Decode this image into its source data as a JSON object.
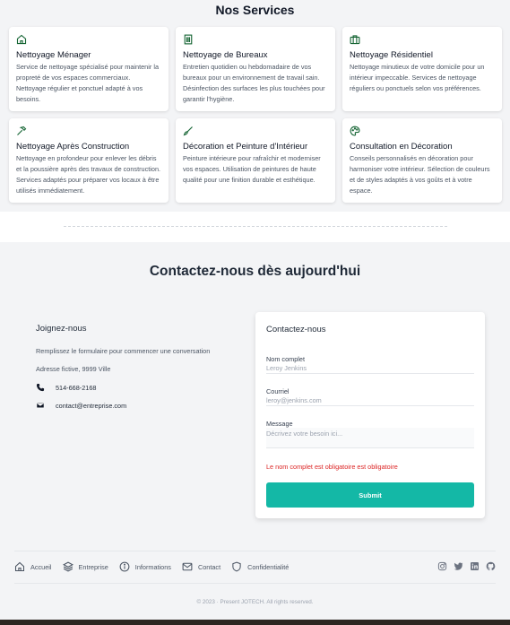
{
  "services": {
    "title": "Nos Services",
    "cards": [
      {
        "icon": "home-icon",
        "title": "Nettoyage Ménager",
        "desc": "Service de nettoyage spécialisé pour maintenir la propreté de vos espaces commerciaux. Nettoyage régulier et ponctuel adapté à vos besoins."
      },
      {
        "icon": "building-icon",
        "title": "Nettoyage de Bureaux",
        "desc": "Entretien quotidien ou hebdomadaire de vos bureaux pour un environnement de travail sain. Désinfection des surfaces les plus touchées pour garantir l'hygiène."
      },
      {
        "icon": "briefcase-icon",
        "title": "Nettoyage Résidentiel",
        "desc": "Nettoyage minutieux de votre domicile pour un intérieur impeccable. Services de nettoyage réguliers ou ponctuels selon vos préférences."
      },
      {
        "icon": "hammer-icon",
        "title": "Nettoyage Après Construction",
        "desc": "Nettoyage en profondeur pour enlever les débris et la poussière après des travaux de construction. Services adaptés pour préparer vos locaux à être utilisés immédiatement."
      },
      {
        "icon": "paint-brush-icon",
        "title": "Décoration et Peinture d'Intérieur",
        "desc": "Peinture intérieure pour rafraîchir et moderniser vos espaces. Utilisation de peintures de haute qualité pour une finition durable et esthétique."
      },
      {
        "icon": "palette-icon",
        "title": "Consultation en Décoration",
        "desc": "Conseils personnalisés en décoration pour harmoniser votre intérieur. Sélection de couleurs et de styles adaptés à vos goûts et à votre espace."
      }
    ]
  },
  "contact": {
    "title": "Contactez-nous dès aujourd'hui",
    "join": {
      "title": "Joignez-nous",
      "desc": "Remplissez le formulaire pour commencer une conversation",
      "address": "Adresse fictive, 9999 Ville",
      "phone": "514-668-2168",
      "email": "contact@entreprise.com"
    },
    "form": {
      "title": "Contactez-nous",
      "name_label": "Nom complet",
      "name_placeholder": "Leroy Jenkins",
      "email_label": "Courriel",
      "email_placeholder": "leroy@jenkins.com",
      "message_label": "Message",
      "message_placeholder": "Décrivez votre besoin ici...",
      "error": "Le nom complet est obligatoire est obligatoire",
      "submit": "Submit"
    }
  },
  "footer": {
    "links": [
      {
        "icon": "home-icon",
        "label": "Accueil"
      },
      {
        "icon": "stack-icon",
        "label": "Entreprise"
      },
      {
        "icon": "info-icon",
        "label": "Informations"
      },
      {
        "icon": "mail-icon",
        "label": "Contact"
      },
      {
        "icon": "shield-icon",
        "label": "Confidentialité"
      }
    ],
    "social": [
      "instagram-icon",
      "twitter-icon",
      "linkedin-icon",
      "github-icon"
    ],
    "copyright": "© 2023 · Present JOTECH. All rights reserved."
  },
  "colors": {
    "accent": "#14b8a6",
    "error": "#dc2626",
    "icon_green": "#166534"
  }
}
